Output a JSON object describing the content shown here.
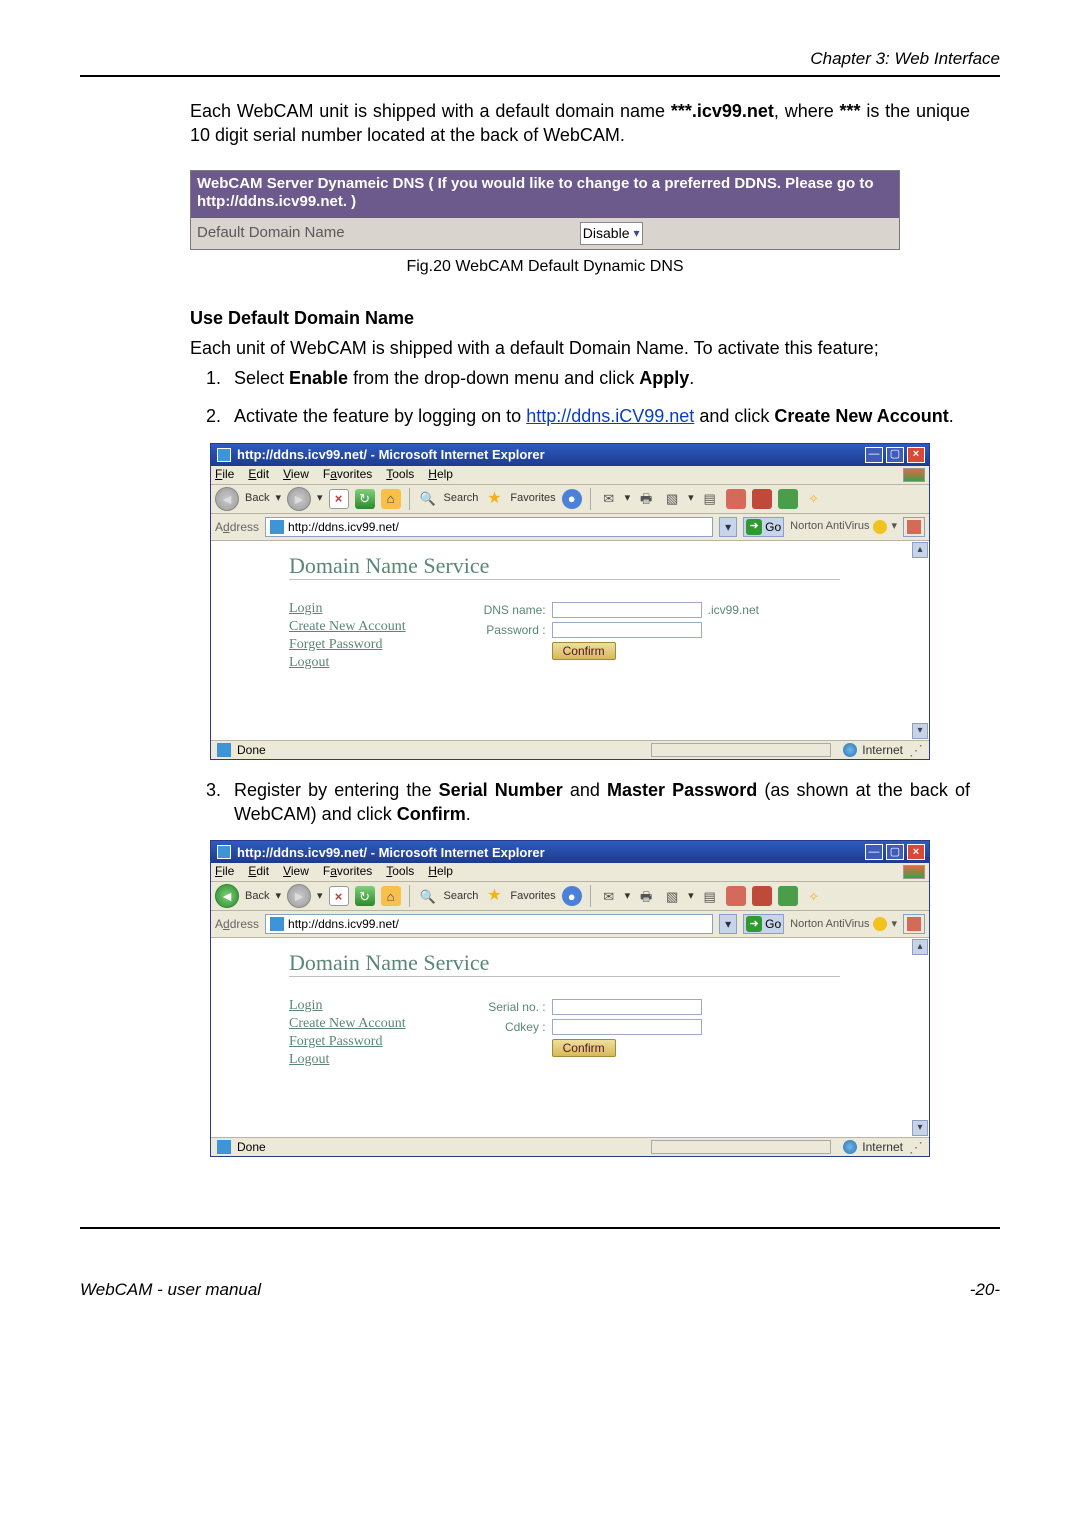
{
  "header": {
    "chapter": "Chapter 3: Web Interface"
  },
  "intro": {
    "p1a": "Each WebCAM unit is shipped with a default domain name ",
    "p1b": "***.icv99.net",
    "p1c": ", where ",
    "p2a": "***",
    "p2b": " is the unique 10 digit serial number located at the back of WebCAM."
  },
  "ddns_box": {
    "title_line1": "WebCAM Server Dynameic DNS ( If you would like to change to a preferred DDNS. Please go to",
    "title_link": "http://ddns.icv99.net.",
    "title_close": " )",
    "label": "Default Domain Name",
    "select_value": "Disable"
  },
  "fig_caption": "Fig.20  WebCAM Default Dynamic DNS",
  "section": {
    "heading": "Use Default Domain Name",
    "lead_a": "Each unit of WebCAM is shipped with a default Domain Name.",
    "lead_b": "    To activate this feature;"
  },
  "steps": [
    {
      "num": "1.",
      "pre": "Select ",
      "b1": "Enable",
      "mid1": " from the drop-down menu and click ",
      "b2": "Apply",
      "post": "."
    },
    {
      "num": "2.",
      "pre": "Activate the feature by logging on to ",
      "link": "http://ddns.iCV99.net",
      "mid1": " and click ",
      "b1": "Create New Account",
      "post": "."
    },
    {
      "num": "3.",
      "pre": "Register by entering the ",
      "b1": "Serial Number",
      "mid1": " and ",
      "b2": "Master Password",
      "mid2": " (as shown at the back of WebCAM) and click ",
      "b3": "Confirm",
      "post": "."
    }
  ],
  "ie": {
    "titlebar": "http://ddns.icv99.net/ - Microsoft Internet Explorer",
    "menu": {
      "file": "File",
      "edit": "Edit",
      "view": "View",
      "favorites": "Favorites",
      "tools": "Tools",
      "help": "Help"
    },
    "toolbar": {
      "back": "Back",
      "search": "Search",
      "favorites": "Favorites"
    },
    "address_label": "Address",
    "address_url": "http://ddns.icv99.net/",
    "go": "Go",
    "norton": "Norton AntiVirus",
    "status_done": "Done",
    "status_zone": "Internet"
  },
  "dns": {
    "title": "Domain Name Service",
    "links": {
      "login": "Login",
      "create": "Create New Account",
      "forget": "Forget Password",
      "logout": "Logout"
    },
    "form1": {
      "dnsname": "DNS name:",
      "suffix": ".icv99.net",
      "password": "Password :"
    },
    "form2": {
      "serial": "Serial no. :",
      "cdkey": "Cdkey :"
    },
    "confirm": "Confirm"
  },
  "footer": {
    "manual": "WebCAM - user manual",
    "page": "-20-"
  }
}
